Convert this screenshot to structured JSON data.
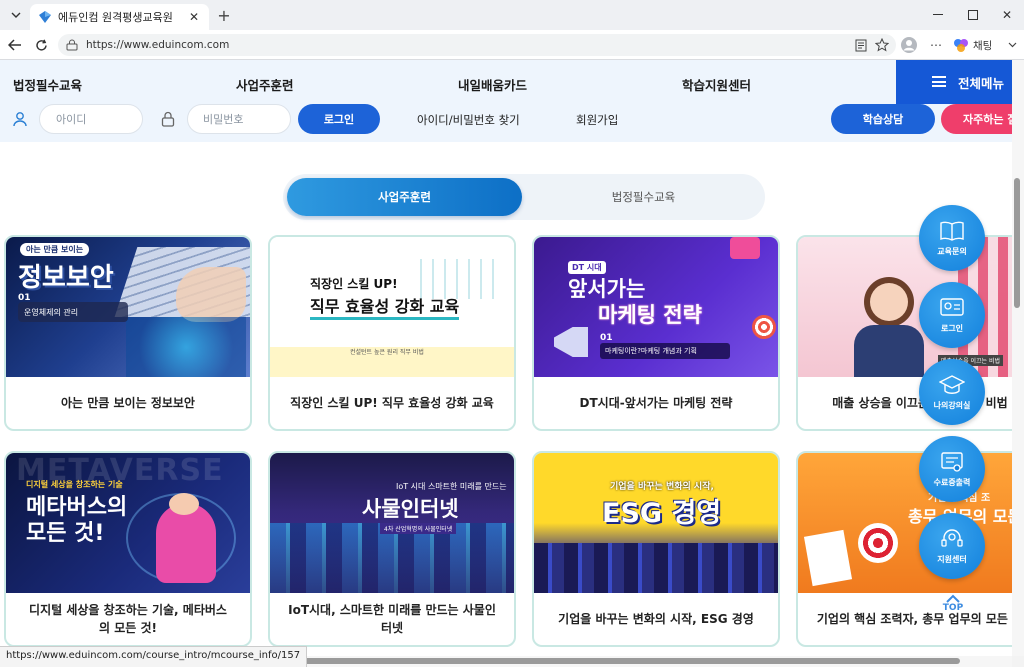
{
  "browser": {
    "tab_title": "에듀인컴 원격평생교육원",
    "url": "https://www.eduincom.com",
    "chat_label": "채팅",
    "status_url": "https://www.eduincom.com/course_intro/mcourse_info/157"
  },
  "header": {
    "menu": [
      "법정필수교육",
      "사업주훈련",
      "내일배움카드",
      "학습지원센터"
    ],
    "all_menu": "전체메뉴",
    "id_placeholder": "아이디",
    "pw_placeholder": "비밀번호",
    "login_button": "로그인",
    "find_link": "아이디/비밀번호 찾기",
    "join_link": "회원가입",
    "consult_button": "학습상담",
    "faq_button": "자주하는 질"
  },
  "toggle": {
    "active": "사업주훈련",
    "inactive": "법정필수교육"
  },
  "courses": [
    {
      "title": "아는 만큼 보이는 정보보안",
      "thumb": {
        "tag": "아는 만큼 보이는",
        "main": "정보보안",
        "num": "01",
        "sub": "운영체제의 관리"
      }
    },
    {
      "title": "직장인 스킬 UP! 직무 효율성 강화 교육",
      "thumb": {
        "l1": "직장인 스킬 UP!",
        "l2": "직무 효율성 강화 교육",
        "foot": "컨설턴트 높은 원리 직무 비법"
      }
    },
    {
      "title": "DT시대-앞서가는 마케팅 전략",
      "thumb": {
        "tag": "DT 시대",
        "l1": "앞서가는",
        "l2": "마케팅 전략",
        "num": "01",
        "sub": "마케팅이란?마케팅 개념과 기획"
      }
    },
    {
      "title": "매출 상승을 이끄는 고객 관리 비법",
      "thumb": {
        "sub": "매출상승을 이끄는 비법"
      }
    },
    {
      "title": "디지털 세상을 창조하는 기술, 메타버스의 모든 것!",
      "thumb": {
        "tag": "디지털 세상을 창조하는 기술",
        "l1": "메타버스의",
        "l2": "모든 것!",
        "bg": "METAVERSE"
      }
    },
    {
      "title": "IoT시대, 스마트한 미래를 만드는 사물인터넷",
      "thumb": {
        "tag": "IoT 시대 스마트한 미래를 만드는",
        "main": "사물인터넷",
        "sub": "4차 산업혁명의 사물인터넷"
      }
    },
    {
      "title": "기업을 바꾸는 변화의 시작, ESG 경영",
      "thumb": {
        "tag": "기업을 바꾸는 변화의 시작,",
        "main": "ESG 경영"
      }
    },
    {
      "title": "기업의 핵심 조력자, 총무 업무의 모든 것",
      "thumb": {
        "tag": "기업의 핵심 조",
        "main": "총무 업무의 모든"
      }
    }
  ],
  "quick_menu": [
    "교육문의",
    "로그인",
    "나의강의실",
    "수료증출력",
    "지원센터"
  ],
  "top_label": "TOP"
}
